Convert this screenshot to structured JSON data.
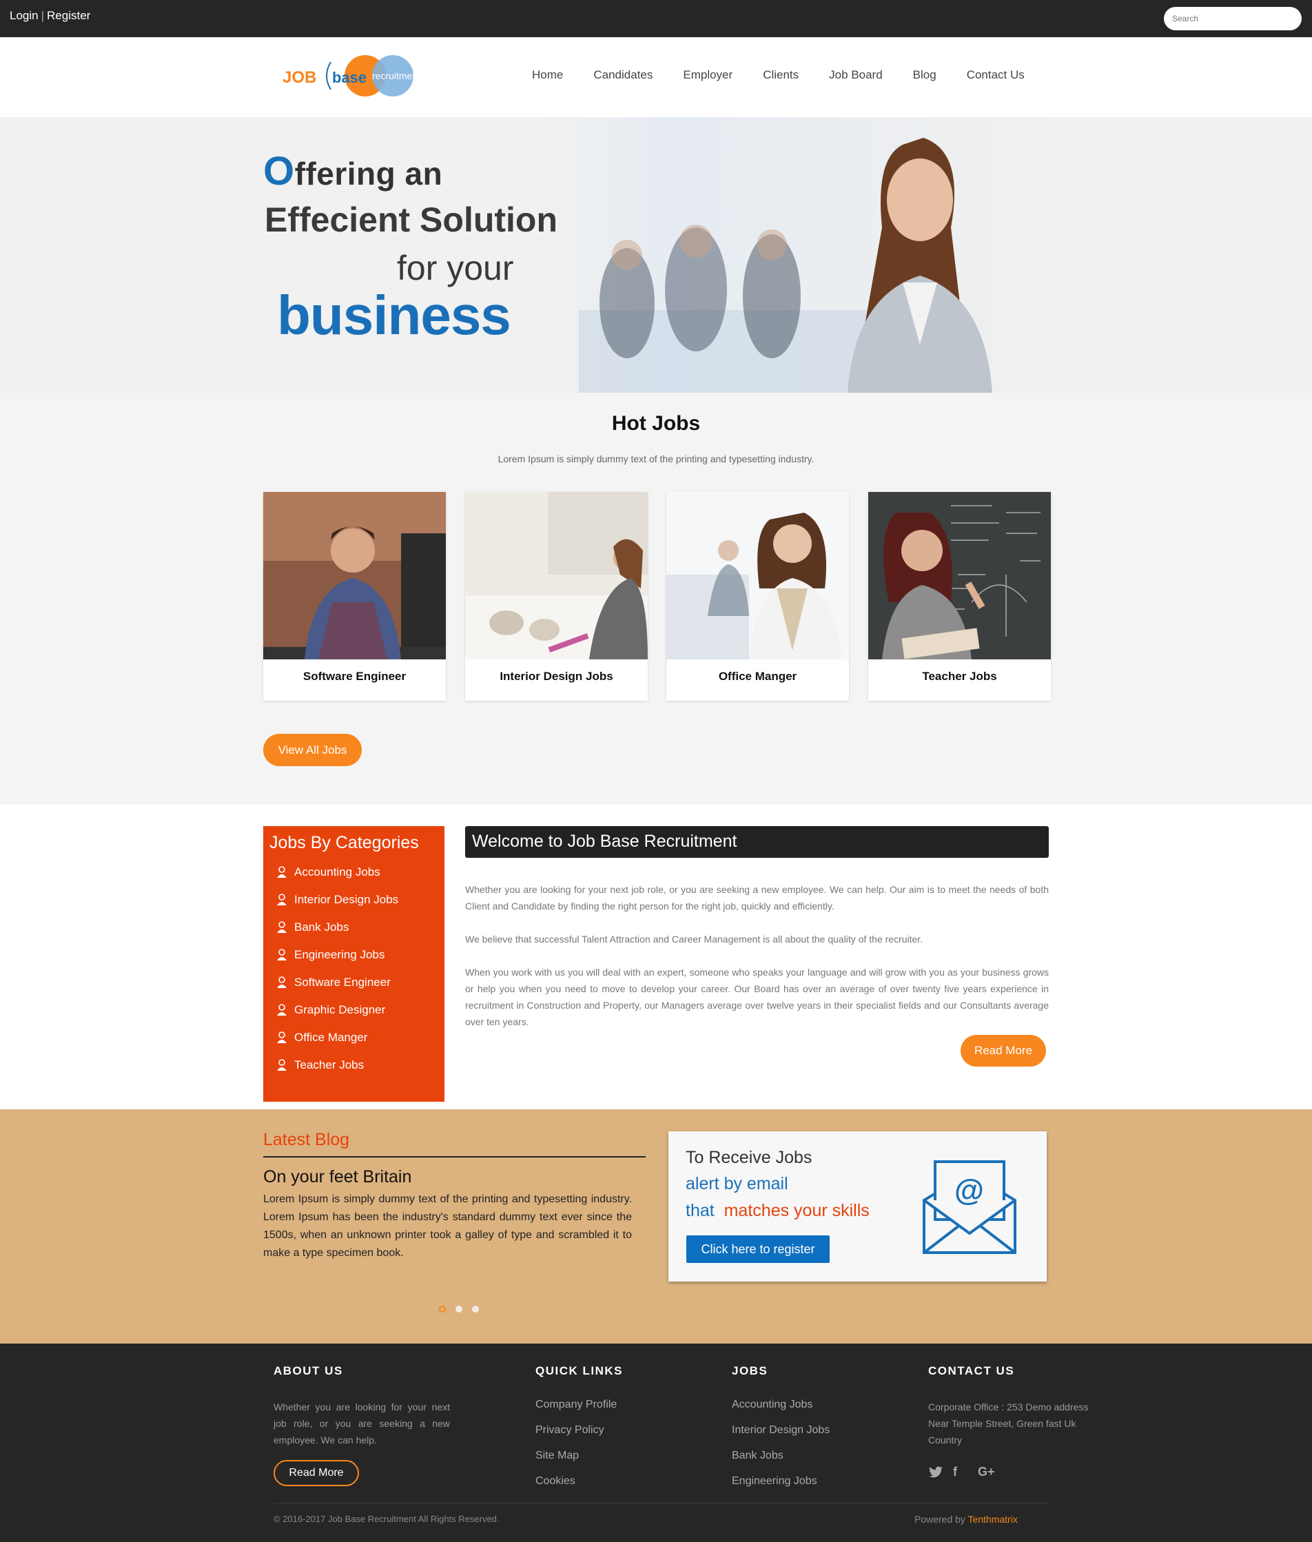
{
  "topbar": {
    "login": "Login",
    "separator": "|",
    "register": "Register",
    "search_placeholder": "Search"
  },
  "logo": {
    "job": "JOB",
    "base": "base",
    "recruitment": "recruitment"
  },
  "nav": [
    "Home",
    "Candidates",
    "Employer",
    "Clients",
    "Job Board",
    "Blog",
    "Contact Us"
  ],
  "hero": {
    "first_letter": "O",
    "line1_rest": "ffering an",
    "line2": "Effecient  Solution",
    "line3": "for your",
    "line4": "business"
  },
  "hot_jobs": {
    "title": "Hot Jobs",
    "subtitle": "Lorem Ipsum is simply dummy text of the printing and typesetting industry.",
    "cards": [
      "Software Engineer",
      "Interior Design Jobs",
      "Office Manger",
      "Teacher Jobs"
    ],
    "view_all": "View All Jobs"
  },
  "categories": {
    "title": "Jobs By Categories",
    "items": [
      "Accounting Jobs",
      "Interior Design Jobs",
      "Bank Jobs",
      "Engineering Jobs",
      "Software Engineer",
      "Graphic Designer",
      "Office Manger",
      "Teacher Jobs"
    ]
  },
  "welcome": {
    "title": "Welcome to Job Base Recruitment",
    "p1": "Whether you are looking for your next job role, or you are seeking a new employee. We can help. Our aim is to meet the needs of both Client and Candidate by finding the right person for the right job, quickly and efficiently.",
    "p2": "We believe that successful Talent Attraction and Career Management is all about the quality of the recruiter.",
    "p3": "When you work with us you will deal with an expert, someone who speaks your language and will grow with you as your business grows or help you when you need to move to develop your career. Our Board has over an average of over twenty five years experience in recruitment in Construction and Property, our Managers average over twelve years in their specialist fields and our Consultants average over ten years.",
    "read_more": "Read More"
  },
  "blog": {
    "heading": "Latest Blog",
    "post_title": "On your feet Britain",
    "post_text": "Lorem Ipsum is simply dummy text of the printing and typesetting industry. Lorem Ipsum has been the industry's standard dummy text ever since the 1500s, when an unknown printer took a galley of type and scrambled it to make a type specimen book."
  },
  "alert": {
    "line1": "To Receive Jobs",
    "line2": "alert by email",
    "line3_a": "that",
    "line3_b": "matches your skills",
    "button": "Click here to register"
  },
  "footer": {
    "about_title": "ABOUT US",
    "about_text": "Whether you are looking for your next job role, or you are seeking a new employee. We can help.",
    "read_more": "Read More",
    "quick_title": "QUICK LINKS",
    "quick_links": [
      "Company Profile",
      "Privacy Policy",
      "Site Map",
      "Cookies"
    ],
    "jobs_title": "JOBS",
    "jobs_links": [
      "Accounting Jobs",
      "Interior Design Jobs",
      "Bank Jobs",
      "Engineering Jobs"
    ],
    "contact_title": "CONTACT US",
    "contact_text": "Corporate Office : 253 Demo address Near Temple Street, Green fast Uk Country",
    "social_icons": [
      "twitter-icon",
      "facebook-icon",
      "google-plus-icon"
    ],
    "copyright": "© 2016-2017 Job Base Recruitment All Rights Reserved.",
    "powered_label": "Powered by",
    "powered_brand": "Tenthmatrix"
  },
  "colors": {
    "accent_orange": "#f7861e",
    "category_red": "#e7430d",
    "brand_blue": "#1a70b8",
    "blog_bg": "#dcb27f",
    "dark": "#262626"
  }
}
